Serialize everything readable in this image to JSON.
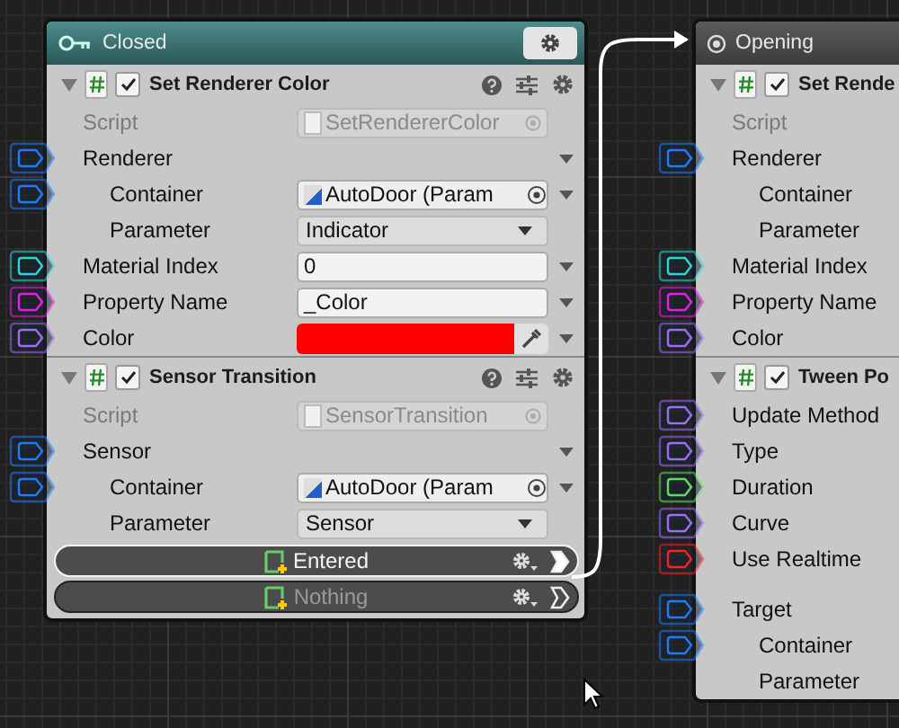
{
  "nodes": [
    {
      "title": "Closed",
      "kind": "key",
      "active": true,
      "components": [
        {
          "title": "Set Renderer Color",
          "enabled": true,
          "expanded": true,
          "fields": [
            {
              "label": "Script",
              "kind": "script",
              "value": "SetRendererColor"
            },
            {
              "label": "Renderer",
              "kind": "none",
              "color": "#1e7cff",
              "foldout": true,
              "children": [
                {
                  "label": "Container",
                  "kind": "object",
                  "value": "AutoDoor (Param",
                  "color": "#1e7cff",
                  "foldout": true
                },
                {
                  "label": "Parameter",
                  "kind": "dropdown",
                  "value": "Indicator"
                }
              ]
            },
            {
              "label": "Material Index",
              "kind": "text",
              "value": "0",
              "color": "#2ad6d6",
              "foldout": true
            },
            {
              "label": "Property Name",
              "kind": "text",
              "value": "_Color",
              "color": "#e81ee8",
              "foldout": true
            },
            {
              "label": "Color",
              "kind": "color",
              "swatch": {
                "color": "#ff0000"
              },
              "color": "#9c6cf2",
              "foldout": true
            }
          ]
        },
        {
          "title": "Sensor Transition",
          "enabled": true,
          "expanded": true,
          "fields": [
            {
              "label": "Script",
              "kind": "script",
              "value": "SensorTransition"
            },
            {
              "label": "Sensor",
              "kind": "none",
              "color": "#1e7cff",
              "foldout": true,
              "children": [
                {
                  "label": "Container",
                  "kind": "object",
                  "value": "AutoDoor (Param",
                  "color": "#1e7cff",
                  "foldout": true
                },
                {
                  "label": "Parameter",
                  "kind": "dropdown",
                  "value": "Sensor"
                }
              ]
            }
          ]
        }
      ],
      "transitions": [
        {
          "label": "Entered",
          "connected": true
        },
        {
          "label": "Nothing",
          "connected": false
        }
      ]
    },
    {
      "title": "Opening",
      "kind": "target",
      "active": false,
      "components": [
        {
          "title": "Set Rende",
          "enabled": true,
          "expanded": true,
          "fields": [
            {
              "label": "Script",
              "kind": "script"
            },
            {
              "label": "Renderer",
              "kind": "none",
              "color": "#1e7cff",
              "children": [
                {
                  "label": "Container",
                  "kind": "none"
                },
                {
                  "label": "Parameter",
                  "kind": "none"
                }
              ]
            },
            {
              "label": "Material Index",
              "kind": "none",
              "color": "#2ad6d6"
            },
            {
              "label": "Property Name",
              "kind": "none",
              "color": "#e81ee8"
            },
            {
              "label": "Color",
              "kind": "none",
              "color": "#9c6cf2"
            }
          ]
        },
        {
          "title": "Tween Po",
          "enabled": true,
          "expanded": true,
          "fields": [
            {
              "label": "Update Method",
              "kind": "none",
              "color": "#9c6cf2"
            },
            {
              "label": "Type",
              "kind": "none",
              "color": "#9c6cf2"
            },
            {
              "label": "Duration",
              "kind": "none",
              "color": "#5ce05c"
            },
            {
              "label": "Curve",
              "kind": "none",
              "color": "#9c6cf2"
            },
            {
              "label": "Use Realtime",
              "kind": "none",
              "color": "#ff2020"
            },
            {
              "label": "Target",
              "kind": "none",
              "color": "#1e7cff",
              "gap": true,
              "children": [
                {
                  "label": "Container",
                  "kind": "none",
                  "color": "#1e7cff"
                },
                {
                  "label": "Parameter",
                  "kind": "none"
                }
              ]
            }
          ]
        }
      ]
    }
  ]
}
